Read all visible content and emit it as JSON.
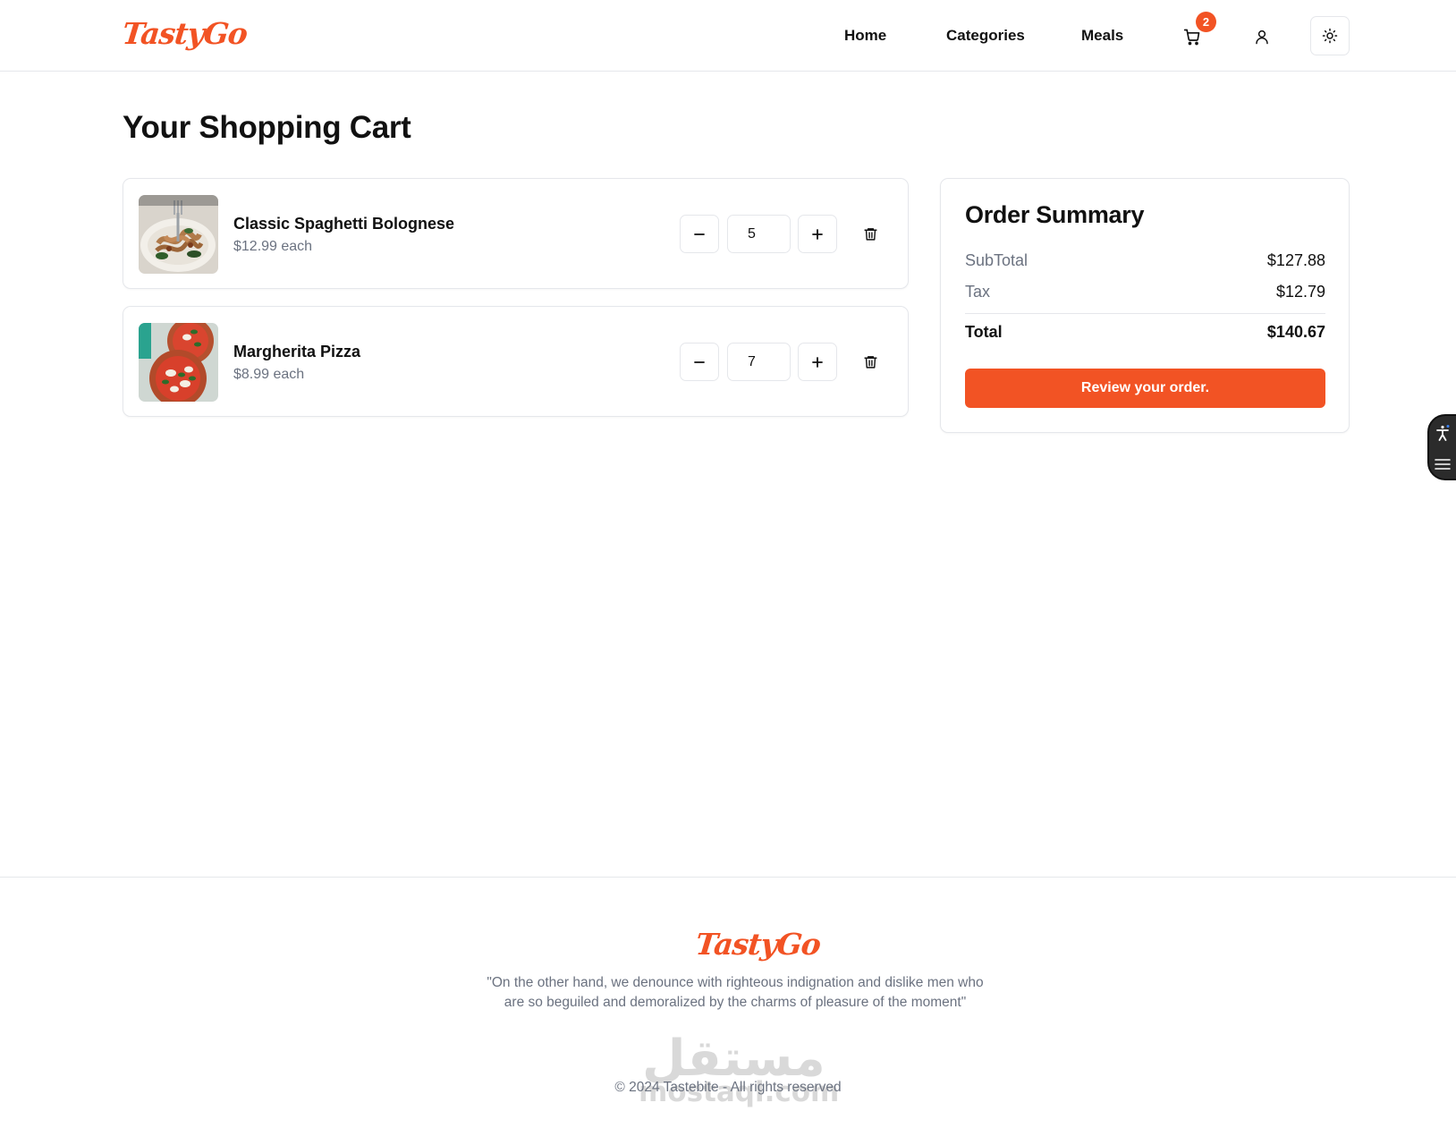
{
  "header": {
    "logo": "TastyGo",
    "nav": [
      {
        "label": "Home"
      },
      {
        "label": "Categories"
      },
      {
        "label": "Meals"
      }
    ],
    "cart_count": "2"
  },
  "page": {
    "title": "Your Shopping Cart"
  },
  "cart": {
    "items": [
      {
        "name": "Classic Spaghetti Bolognese",
        "price": "$12.99 each",
        "quantity": "5"
      },
      {
        "name": "Margherita Pizza",
        "price": "$8.99 each",
        "quantity": "7"
      }
    ]
  },
  "summary": {
    "title": "Order Summary",
    "subtotal_label": "SubTotal",
    "subtotal_value": "$127.88",
    "tax_label": "Tax",
    "tax_value": "$12.79",
    "total_label": "Total",
    "total_value": "$140.67",
    "button_label": "Review your order."
  },
  "footer": {
    "logo": "TastyGo",
    "quote": "\"On the other hand, we denounce with righteous indignation and dislike men who are so beguiled and demoralized by the charms of pleasure of the moment\"",
    "copyright": "© 2024 Tastebite - All rights reserved",
    "watermark_ar": "مستقل",
    "watermark_en": "mostaql.com"
  },
  "colors": {
    "accent": "#f25324",
    "text": "#111111",
    "muted": "#6b7280",
    "border": "#e5e7eb"
  },
  "icons": [
    "cart-icon",
    "user-icon",
    "sun-icon",
    "minus-icon",
    "plus-icon",
    "trash-icon",
    "accessibility-icon",
    "menu-icon"
  ]
}
